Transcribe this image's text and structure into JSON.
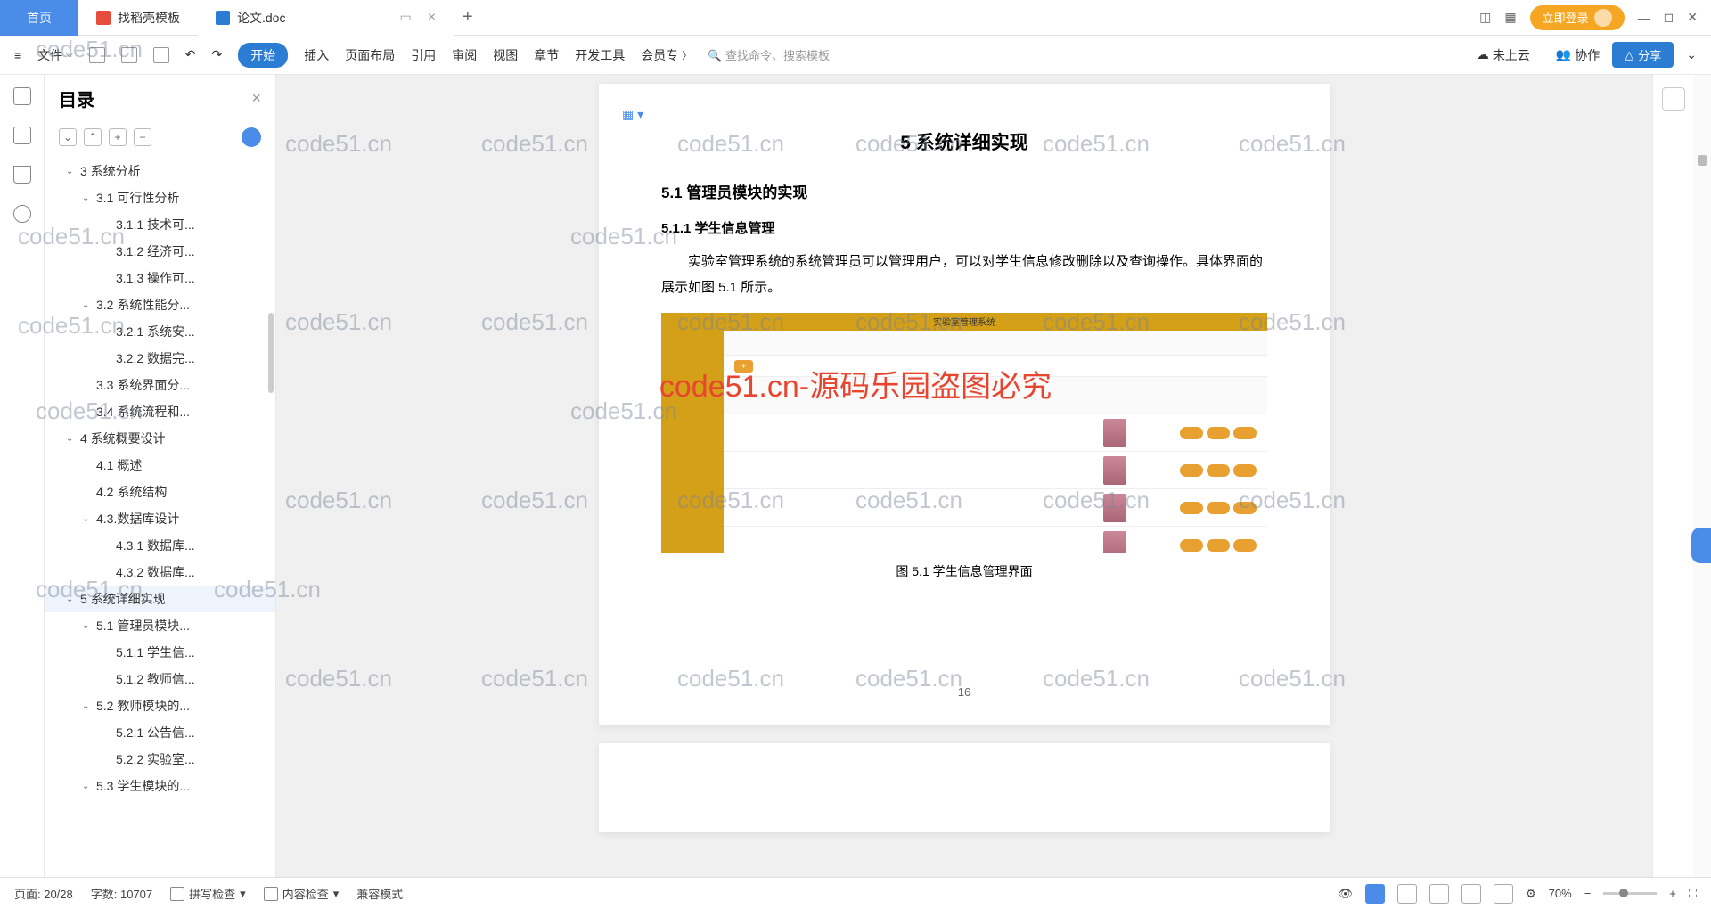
{
  "tabs": {
    "home": "首页",
    "template": "找稻壳模板",
    "doc": "论文.doc"
  },
  "titlebar": {
    "login": "立即登录"
  },
  "toolbar": {
    "file": "文件",
    "start": "开始",
    "insert": "插入",
    "layout": "页面布局",
    "reference": "引用",
    "review": "审阅",
    "view": "视图",
    "chapter": "章节",
    "devtools": "开发工具",
    "member": "会员专",
    "search": "查找命令、搜索模板",
    "cloud": "未上云",
    "collab": "协作",
    "share": "分享"
  },
  "outline": {
    "title": "目录",
    "items": [
      {
        "lvl": 1,
        "exp": true,
        "text": "3 系统分析"
      },
      {
        "lvl": 2,
        "exp": true,
        "text": "3.1 可行性分析"
      },
      {
        "lvl": 3,
        "text": "3.1.1 技术可..."
      },
      {
        "lvl": 3,
        "text": "3.1.2 经济可..."
      },
      {
        "lvl": 3,
        "text": "3.1.3 操作可..."
      },
      {
        "lvl": 2,
        "exp": true,
        "text": "3.2 系统性能分..."
      },
      {
        "lvl": 3,
        "text": "3.2.1 系统安..."
      },
      {
        "lvl": 3,
        "text": "3.2.2 数据完..."
      },
      {
        "lvl": 2,
        "text": "3.3 系统界面分..."
      },
      {
        "lvl": 2,
        "text": "3.4 系统流程和..."
      },
      {
        "lvl": 1,
        "exp": true,
        "text": "4 系统概要设计"
      },
      {
        "lvl": 2,
        "text": "4.1 概述"
      },
      {
        "lvl": 2,
        "text": "4.2 系统结构"
      },
      {
        "lvl": 2,
        "exp": true,
        "text": "4.3.数据库设计"
      },
      {
        "lvl": 3,
        "text": "4.3.1 数据库..."
      },
      {
        "lvl": 3,
        "text": "4.3.2 数据库..."
      },
      {
        "lvl": 1,
        "exp": true,
        "text": "5 系统详细实现",
        "active": true
      },
      {
        "lvl": 2,
        "exp": true,
        "text": "5.1 管理员模块..."
      },
      {
        "lvl": 3,
        "text": "5.1.1 学生信..."
      },
      {
        "lvl": 3,
        "text": "5.1.2 教师信..."
      },
      {
        "lvl": 2,
        "exp": true,
        "text": "5.2 教师模块的..."
      },
      {
        "lvl": 3,
        "text": "5.2.1 公告信..."
      },
      {
        "lvl": 3,
        "text": "5.2.2 实验室..."
      },
      {
        "lvl": 2,
        "exp": true,
        "text": "5.3 学生模块的..."
      }
    ]
  },
  "doc": {
    "h1": "5 系统详细实现",
    "h2": "5.1 管理员模块的实现",
    "h3": "5.1.1 学生信息管理",
    "p1": "实验室管理系统的系统管理员可以管理用户，可以对学生信息修改删除以及查询操作。具体界面的展示如图 5.1 所示。",
    "mock_title": "实验室管理系统",
    "caption": "图 5.1 学生信息管理界面",
    "pagenum": "16"
  },
  "status": {
    "page": "页面: 20/28",
    "words": "字数: 10707",
    "spell": "拼写检查",
    "content": "内容检查",
    "compat": "兼容模式",
    "zoom": "70%"
  },
  "watermark": "code51.cn",
  "wm_red": "code51.cn-源码乐园盗图必究"
}
